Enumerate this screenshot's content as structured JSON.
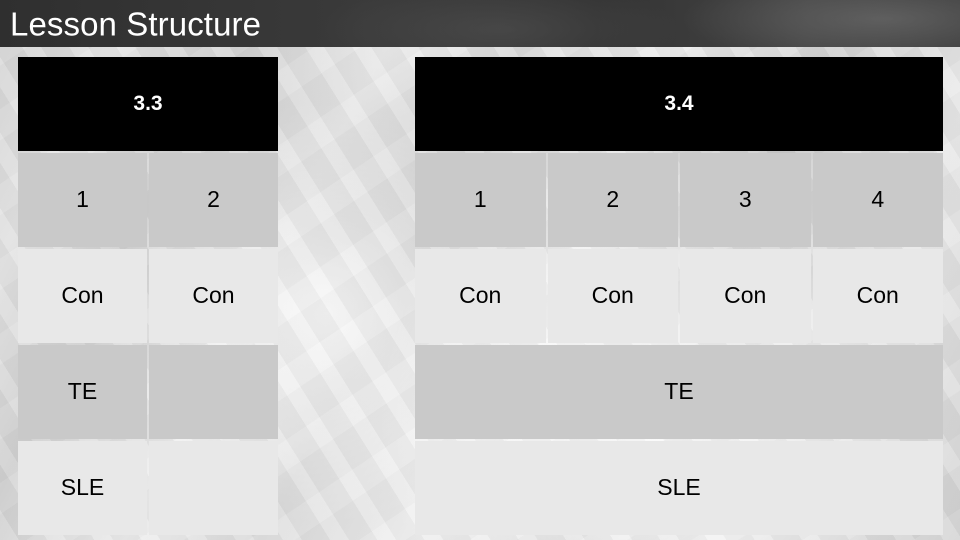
{
  "slide": {
    "title": "Lesson Structure",
    "background_kind": "machinery-photo",
    "colors": {
      "title_bar": "#373737",
      "title_text": "#ffffff",
      "header_cell": "#000000",
      "dark_row": "#c9c9c9",
      "light_row": "#e8e8e8",
      "cell_text": "#000000",
      "cell_gap": "#ffffff"
    }
  },
  "tables": [
    {
      "id": "3.3",
      "header": "3.3",
      "columns": 2,
      "rows": [
        {
          "kind": "numbers",
          "tone": "dark",
          "cells": [
            "1",
            "2"
          ]
        },
        {
          "kind": "content",
          "tone": "light",
          "cells": [
            "Con",
            "Con"
          ]
        },
        {
          "kind": "content",
          "tone": "dark",
          "cells": [
            "TE",
            ""
          ]
        },
        {
          "kind": "content",
          "tone": "light",
          "cells": [
            "SLE",
            ""
          ]
        }
      ]
    },
    {
      "id": "3.4",
      "header": "3.4",
      "columns": 4,
      "rows": [
        {
          "kind": "numbers",
          "tone": "dark",
          "cells": [
            "1",
            "2",
            "3",
            "4"
          ]
        },
        {
          "kind": "content",
          "tone": "light",
          "cells": [
            "Con",
            "Con",
            "Con",
            "Con"
          ]
        },
        {
          "kind": "merged",
          "tone": "dark",
          "cells": [
            "TE"
          ]
        },
        {
          "kind": "merged",
          "tone": "light",
          "cells": [
            "SLE"
          ]
        }
      ]
    }
  ]
}
